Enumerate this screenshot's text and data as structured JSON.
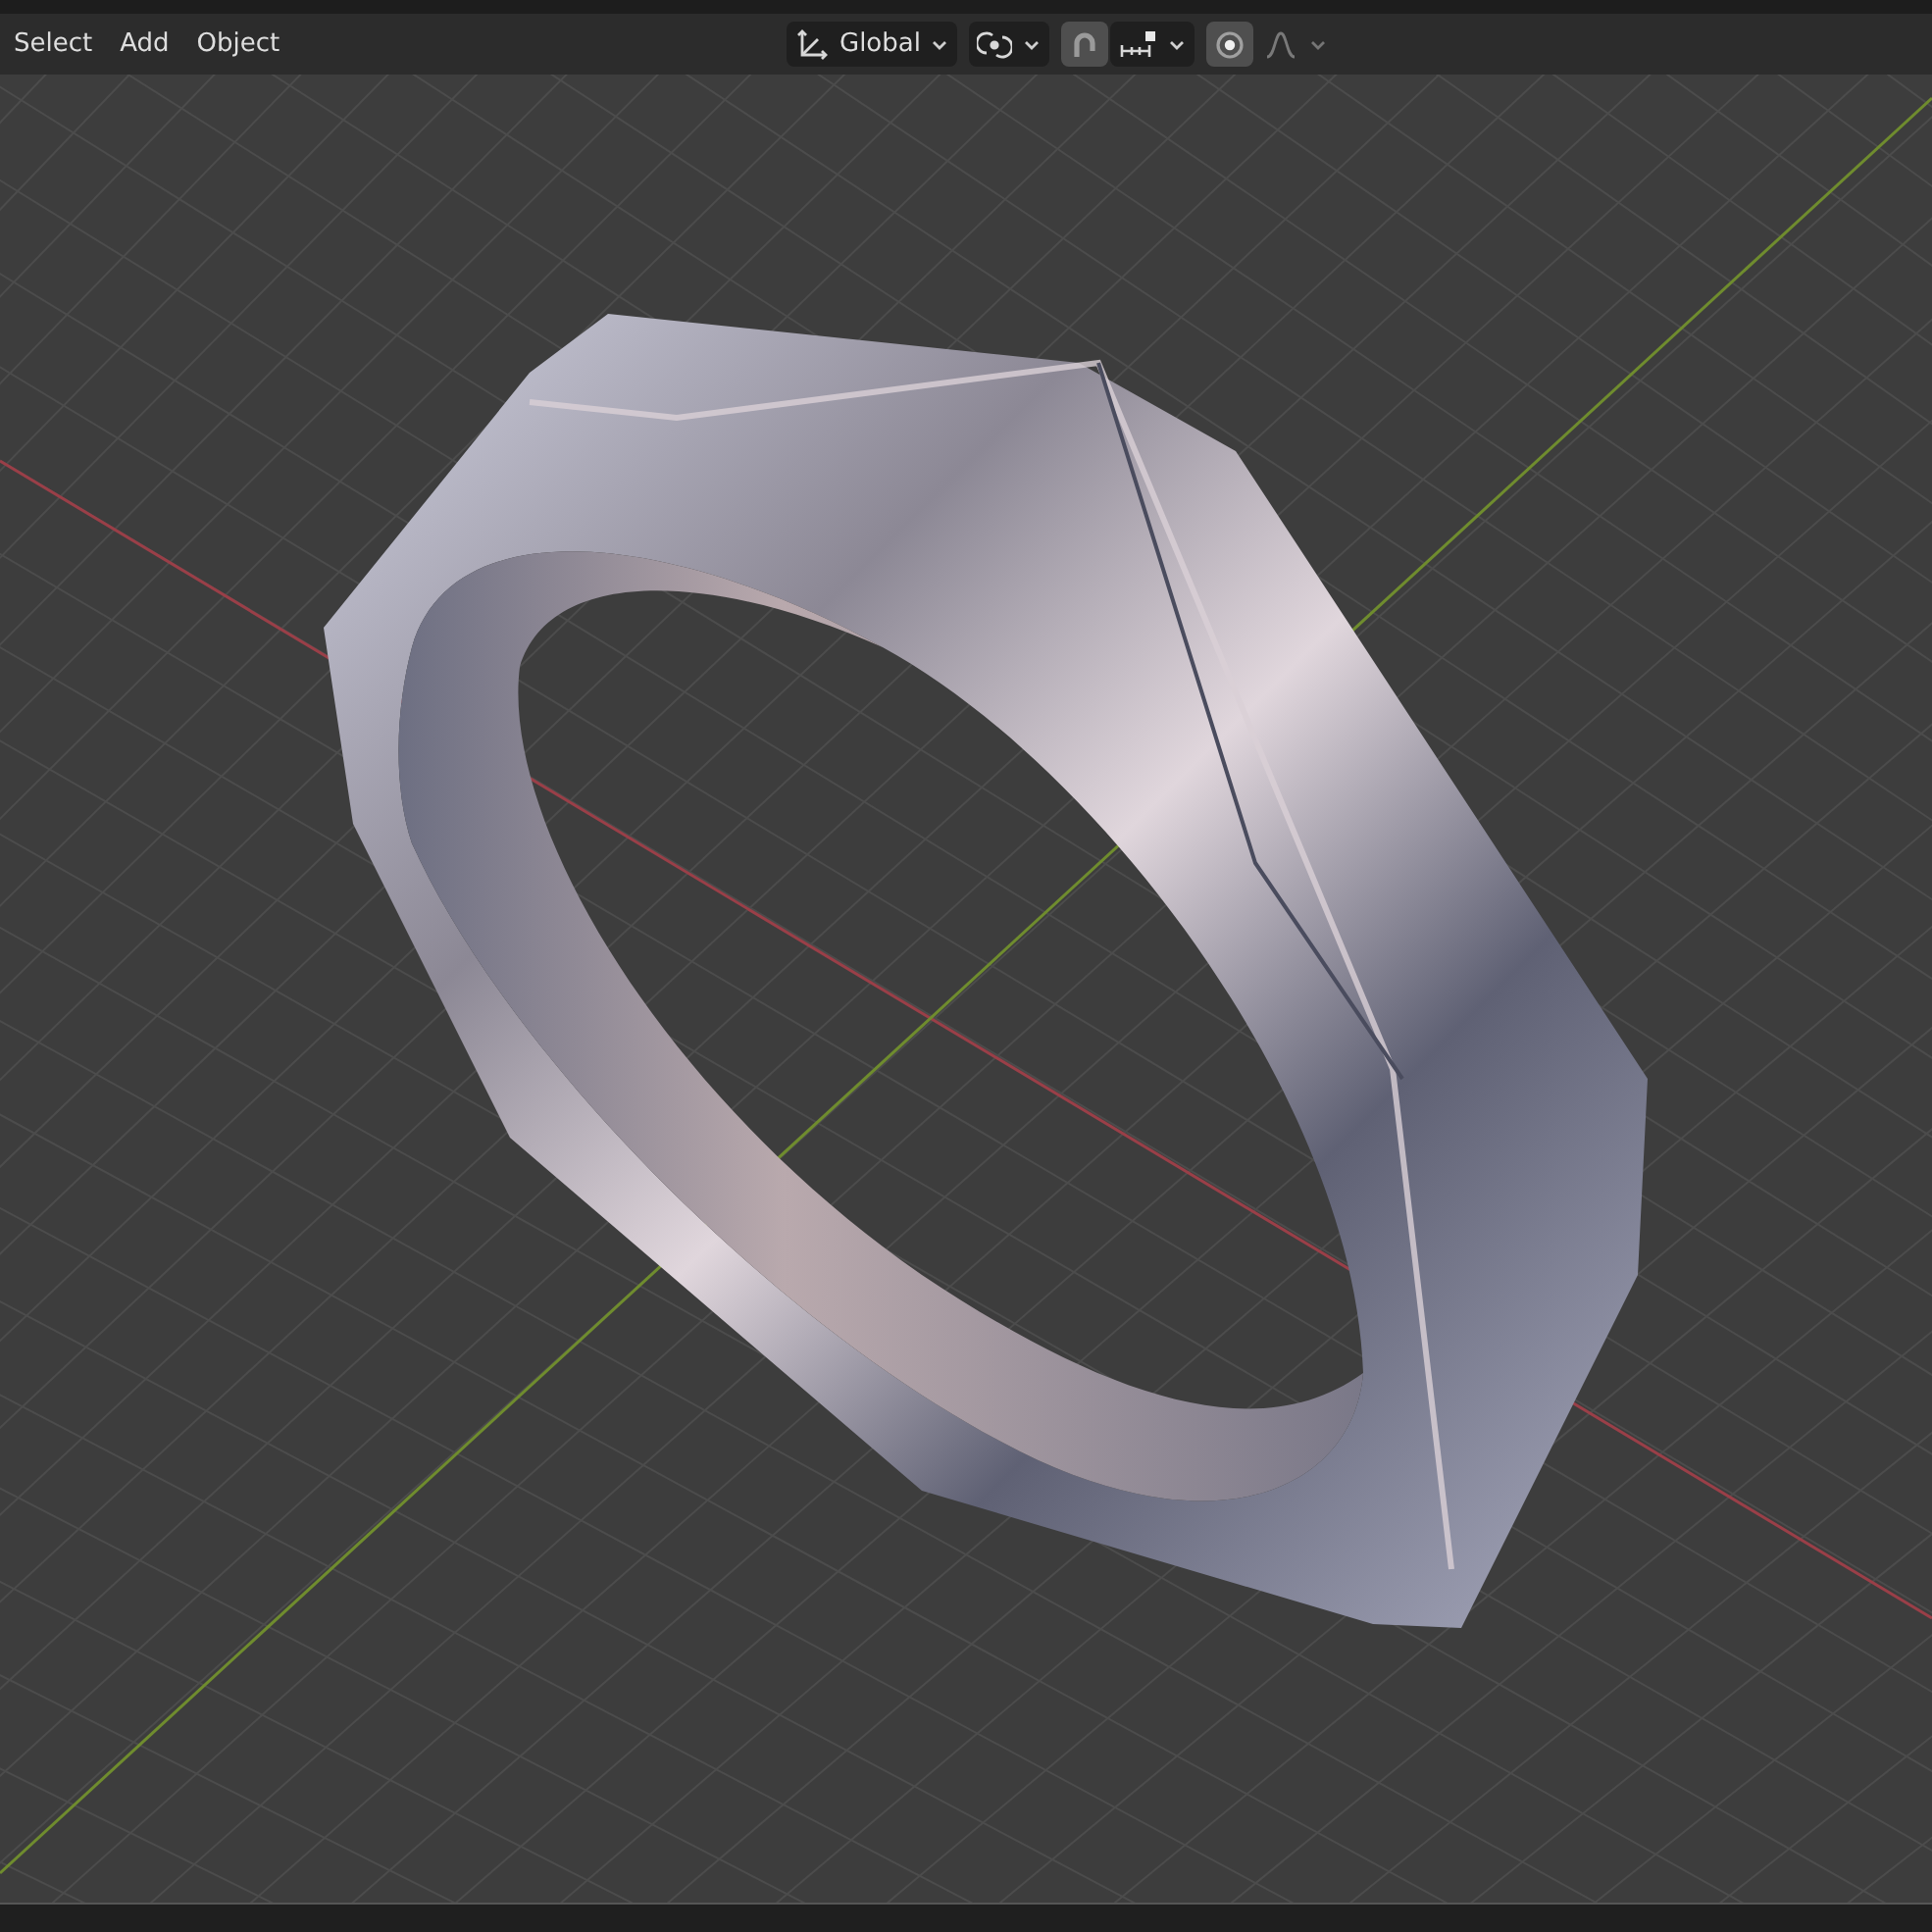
{
  "header": {
    "menus": [
      "Select",
      "Add",
      "Object"
    ],
    "transform_orientation": {
      "value": "Global"
    },
    "snap": {
      "on": true
    },
    "proportional_editing": {
      "on": true
    }
  }
}
